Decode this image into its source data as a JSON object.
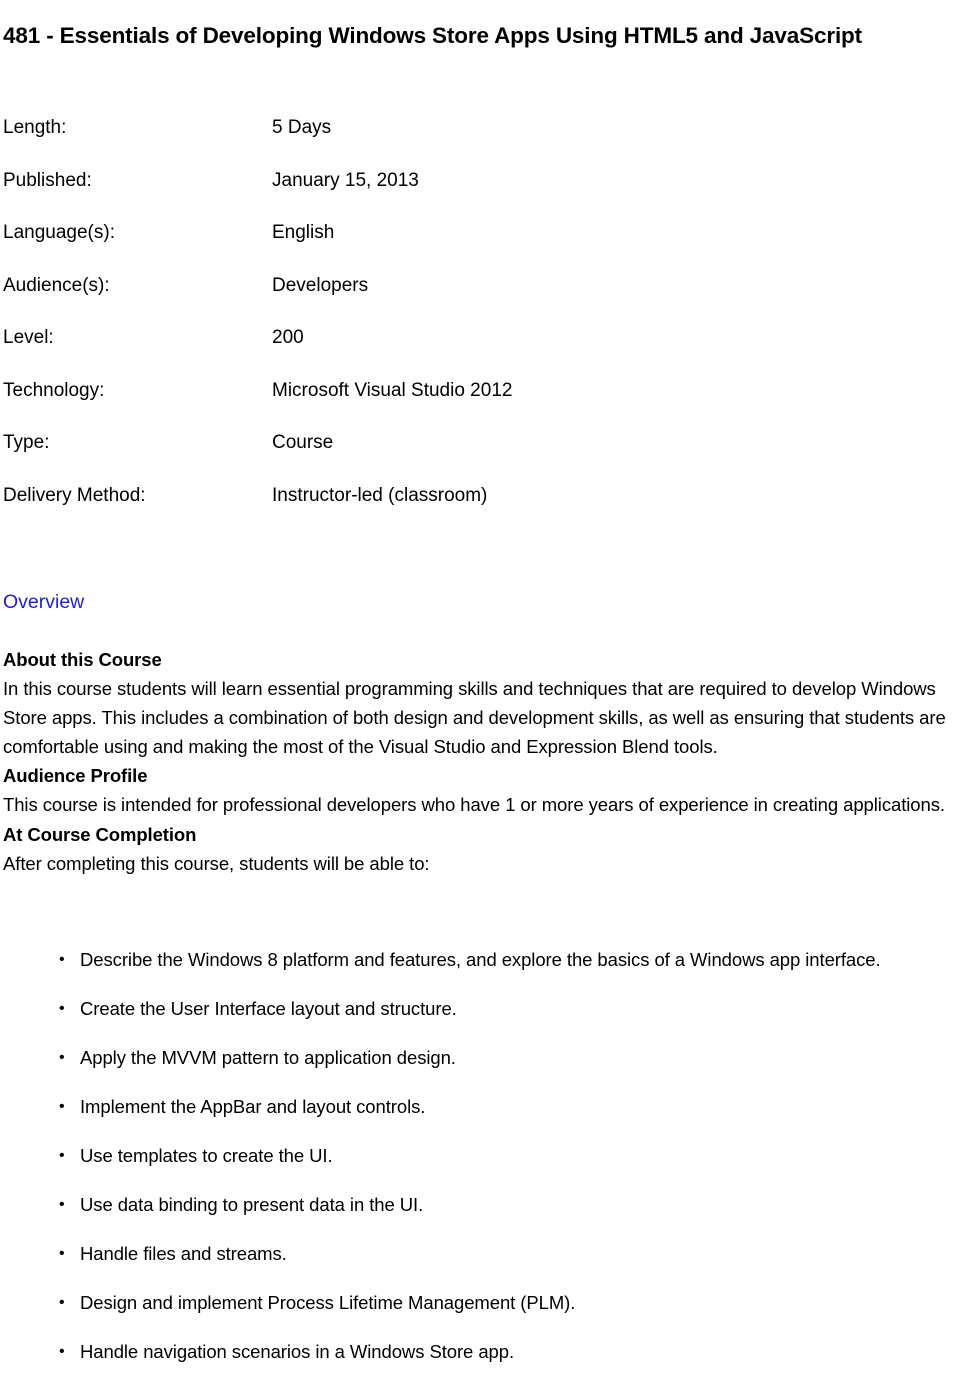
{
  "document": {
    "title": "481 - Essentials of Developing Windows Store Apps Using HTML5 and JavaScript",
    "accent_color": "#2222cc",
    "text_color": "#000000",
    "background_color": "#ffffff"
  },
  "metadata": {
    "rows": [
      {
        "label": "Length:",
        "value": "5 Days"
      },
      {
        "label": "Published:",
        "value": "January 15, 2013"
      },
      {
        "label": "Language(s):",
        "value": "English"
      },
      {
        "label": "Audience(s):",
        "value": "Developers"
      },
      {
        "label": "Level:",
        "value": "200"
      },
      {
        "label": "Technology:",
        "value": "Microsoft Visual Studio 2012"
      },
      {
        "label": "Type:",
        "value": "Course"
      },
      {
        "label": "Delivery Method:",
        "value": "Instructor-led (classroom)"
      }
    ]
  },
  "overview": {
    "link_label": "Overview",
    "about": {
      "heading": "About this Course",
      "body": "In this course students will learn essential programming skills and techniques that are required to develop Windows Store apps. This includes a combination of both design and development skills, as well as ensuring that students are comfortable using and making the most of the Visual Studio and Expression Blend tools."
    },
    "audience": {
      "heading": "Audience Profile",
      "body": "This course is intended for professional developers who have 1 or more years of experience in creating applications."
    },
    "completion": {
      "heading": "At Course Completion",
      "intro": "After completing this course, students will be able to:",
      "bullet_marker": "•",
      "items": [
        "Describe the Windows 8 platform and features, and explore the basics of a Windows app interface.",
        "Create the User Interface layout and structure.",
        "Apply the MVVM pattern to application design.",
        "Implement the AppBar and layout controls.",
        "Use templates to create the UI.",
        "Use data binding to present data in the UI.",
        "Handle files and streams.",
        "Design and implement Process Lifetime Management (PLM).",
        "Handle navigation scenarios in a Windows Store app."
      ]
    }
  }
}
